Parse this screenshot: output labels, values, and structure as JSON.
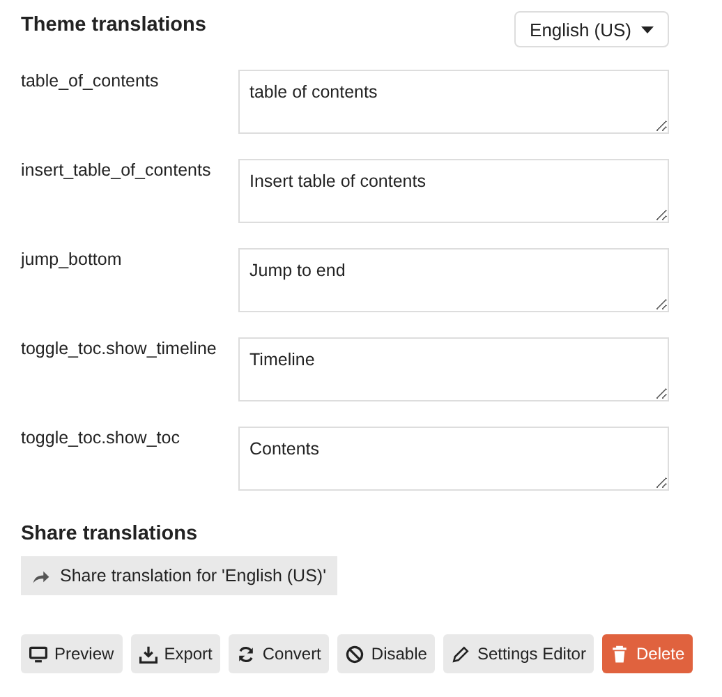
{
  "header": {
    "title": "Theme translations",
    "language": "English (US)"
  },
  "translations": [
    {
      "key": "table_of_contents",
      "value": "table of contents"
    },
    {
      "key": "insert_table_of_contents",
      "value": "Insert table of contents"
    },
    {
      "key": "jump_bottom",
      "value": "Jump to end"
    },
    {
      "key": "toggle_toc.show_timeline",
      "value": "Timeline"
    },
    {
      "key": "toggle_toc.show_toc",
      "value": "Contents"
    }
  ],
  "share": {
    "title": "Share translations",
    "button": "Share translation for 'English (US)'"
  },
  "actions": [
    {
      "label": "Preview",
      "kind": "default"
    },
    {
      "label": "Export",
      "kind": "default"
    },
    {
      "label": "Convert",
      "kind": "default"
    },
    {
      "label": "Disable",
      "kind": "default"
    },
    {
      "label": "Settings Editor",
      "kind": "default"
    },
    {
      "label": "Delete",
      "kind": "danger"
    }
  ]
}
